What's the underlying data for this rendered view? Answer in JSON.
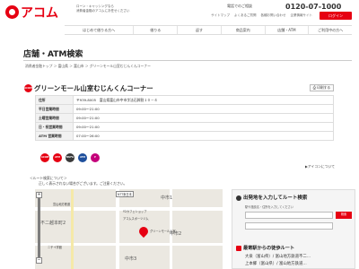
{
  "header": {
    "logo_text": "アコム",
    "tagline_line1": "ローン・キャッシングなら",
    "tagline_line2": "消費者金融のアコムにお任せください",
    "phone_label": "電話でのご相談",
    "phone_number": "0120-07-1000",
    "util_links": [
      "サイトマップ",
      "よくあるご質問",
      "各種お問い合わせ",
      "企業情報サイト"
    ],
    "login_label": "ログイン"
  },
  "nav": {
    "items": [
      "はじめて借りる方へ",
      "借りる",
      "返す",
      "商品案内",
      "店舗・ATM",
      "ご利用中の方へ"
    ]
  },
  "page": {
    "title": "店舗・ATM検索",
    "breadcrumb": "消費者金融トップ ＞ 富山県 ＞ 富山市 ＞ グリーンモール山室むじんくんコーナー"
  },
  "store": {
    "badge_text": "ACOM",
    "name": "グリーンモール山室むじんくんコーナー",
    "print_label": "印刷する",
    "info": [
      {
        "label": "住所",
        "value": "〒939-8005　富山県富山市中市字法石鉾割１０－４"
      },
      {
        "label": "平日営業時間",
        "value": "09:00～21:00"
      },
      {
        "label": "土曜営業時間",
        "value": "09:00～21:00"
      },
      {
        "label": "日・祝営業時間",
        "value": "09:00～21:00"
      },
      {
        "label": "ATM 営業時間",
        "value": "07:00～26:00"
      }
    ]
  },
  "services": [
    {
      "name": "ACOM",
      "color": "#e60012"
    },
    {
      "name": "ATM",
      "color": "#e60012"
    },
    {
      "name": "MUFG",
      "color": "#3a3a3a"
    },
    {
      "name": "ATM",
      "color": "#1e4f9c"
    },
    {
      "name": "P",
      "color": "#c4007a"
    }
  ],
  "icon_desc_label": "アイコンについて",
  "route_note_line1": "＜ルート検索について＞",
  "route_note_line2": "正しく表示されない場合がございます。ご注意ください。",
  "map": {
    "labels": [
      "NTT東日本",
      "中市1",
      "中市2",
      "不二越本町2",
      "中市3",
      "グリーンモール山室",
      "ニチイ学館",
      "アコムスポーツジム",
      "富山地方鉄道",
      "Y2カフェショップ"
    ]
  },
  "route": {
    "heading": "出発地を入力してルート検索",
    "step_label": "駅や施設名・住所を入力してください",
    "go_label": "検索",
    "station_heading": "最寄駅からの徒歩ルート",
    "stations": [
      "大泉（富山県）/ 富山地方鉄道不二…",
      "上本郷（富山県）/ 富山地方鉄道…"
    ]
  }
}
